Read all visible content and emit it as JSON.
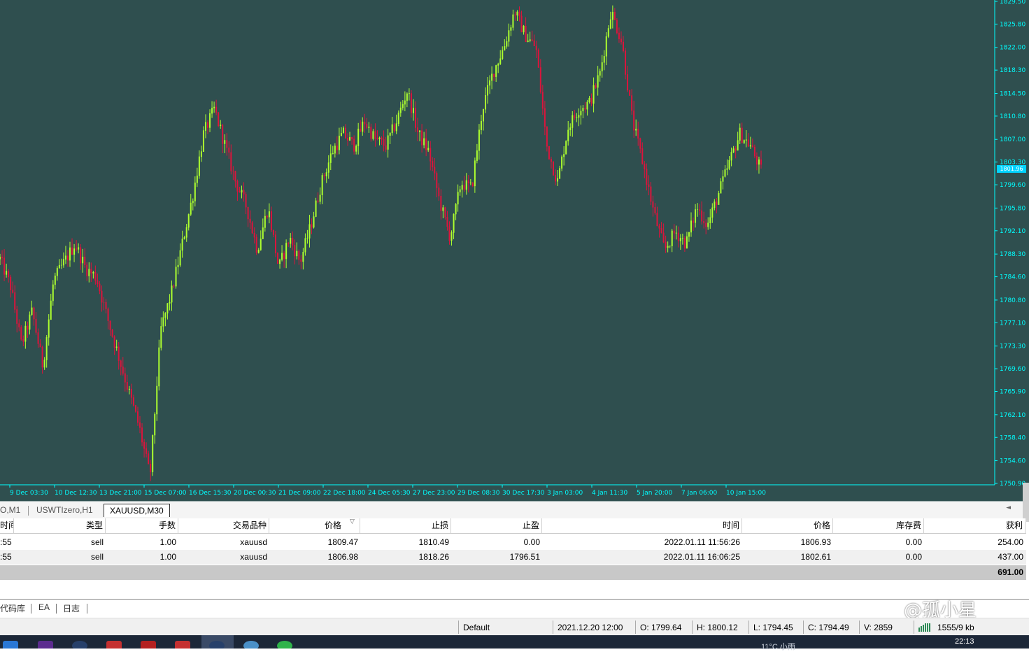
{
  "chart": {
    "price_tag": "1801.96",
    "y_ticks": [
      "1829.50",
      "1825.80",
      "1822.00",
      "1818.30",
      "1814.50",
      "1810.80",
      "1807.00",
      "1803.30",
      "1799.60",
      "1795.80",
      "1792.10",
      "1788.30",
      "1784.60",
      "1780.80",
      "1777.10",
      "1773.30",
      "1769.60",
      "1765.90",
      "1762.10",
      "1758.40",
      "1754.60",
      "1750.90"
    ],
    "x_ticks": [
      "9 Dec 03:30",
      "10 Dec 12:30",
      "13 Dec 21:00",
      "15 Dec 07:00",
      "16 Dec 15:30",
      "20 Dec 00:30",
      "21 Dec 09:00",
      "22 Dec 18:00",
      "24 Dec 05:30",
      "27 Dec 23:00",
      "29 Dec 08:30",
      "30 Dec 17:30",
      "3 Jan 03:00",
      "4 Jan 11:30",
      "5 Jan 20:00",
      "7 Jan 06:00",
      "10 Jan 15:00"
    ],
    "colors": {
      "background": "#2f4f4f",
      "up": "#adff2f",
      "down": "#dc143c",
      "axis": "#00ffff"
    }
  },
  "chart_data": {
    "type": "candlestick",
    "symbol": "XAUUSD",
    "timeframe": "M30",
    "ylim": [
      1750.9,
      1829.5
    ],
    "close_path": [
      [
        "9 Dec 03:30",
        1787.5
      ],
      [
        "",
        1783.0
      ],
      [
        "",
        1773.5
      ],
      [
        "",
        1779.0
      ],
      [
        "",
        1770.0
      ],
      [
        "10 Dec 12:30",
        1784.0
      ],
      [
        "",
        1787.0
      ],
      [
        "",
        1790.0
      ],
      [
        "",
        1786.0
      ],
      [
        "13 Dec 21:00",
        1784.5
      ],
      [
        "",
        1778.0
      ],
      [
        "",
        1772.0
      ],
      [
        "",
        1766.0
      ],
      [
        "",
        1760.0
      ],
      [
        "",
        1752.0
      ],
      [
        "15 Dec 07:00",
        1776.0
      ],
      [
        "",
        1782.0
      ],
      [
        "",
        1790.0
      ],
      [
        "16 Dec 15:30",
        1798.0
      ],
      [
        "",
        1808.0
      ],
      [
        "",
        1812.0
      ],
      [
        "",
        1806.0
      ],
      [
        "20 Dec 00:30",
        1800.0
      ],
      [
        "",
        1796.0
      ],
      [
        "",
        1789.0
      ],
      [
        "21 Dec 09:00",
        1796.0
      ],
      [
        "",
        1786.0
      ],
      [
        "",
        1791.0
      ],
      [
        "",
        1787.0
      ],
      [
        "",
        1793.0
      ],
      [
        "22 Dec 18:00",
        1800.0
      ],
      [
        "",
        1805.0
      ],
      [
        "",
        1808.0
      ],
      [
        "",
        1806.0
      ],
      [
        "24 Dec 05:30",
        1810.0
      ],
      [
        "",
        1807.0
      ],
      [
        "",
        1806.0
      ],
      [
        "27 Dec 23:00",
        1810.0
      ],
      [
        "",
        1815.0
      ],
      [
        "",
        1808.0
      ],
      [
        "",
        1805.0
      ],
      [
        "29 Dec 08:30",
        1797.0
      ],
      [
        "",
        1791.0
      ],
      [
        "",
        1800.0
      ],
      [
        "",
        1799.0
      ],
      [
        "30 Dec 17:30",
        1812.0
      ],
      [
        "",
        1818.0
      ],
      [
        "",
        1822.0
      ],
      [
        "",
        1828.0
      ],
      [
        "3 Jan 03:00",
        1824.0
      ],
      [
        "",
        1822.0
      ],
      [
        "",
        1806.0
      ],
      [
        "",
        1800.0
      ],
      [
        "4 Jan 11:30",
        1809.0
      ],
      [
        "",
        1812.0
      ],
      [
        "",
        1813.0
      ],
      [
        "",
        1818.0
      ],
      [
        "",
        1828.0
      ],
      [
        "5 Jan 20:00",
        1823.0
      ],
      [
        "",
        1810.0
      ],
      [
        "",
        1803.0
      ],
      [
        "",
        1795.0
      ],
      [
        "",
        1789.0
      ],
      [
        "7 Jan 06:00",
        1792.0
      ],
      [
        "",
        1790.0
      ],
      [
        "",
        1796.0
      ],
      [
        "",
        1793.0
      ],
      [
        "10 Jan 15:00",
        1798.0
      ],
      [
        "",
        1803.0
      ],
      [
        "",
        1808.0
      ],
      [
        "",
        1806.0
      ],
      [
        "",
        1801.96
      ]
    ]
  },
  "tabs": {
    "items": [
      "O,M1",
      "USWTIzero,H1",
      "XAUUSD,M30"
    ],
    "active": "XAUUSD,M30"
  },
  "trade_grid": {
    "headers": [
      "时间",
      "类型",
      "手数",
      "交易品种",
      "价格",
      "止损",
      "止盈",
      "时间",
      "价格",
      "库存费",
      "获利"
    ],
    "rows": [
      [
        ":55",
        "sell",
        "1.00",
        "xauusd",
        "1809.47",
        "1810.49",
        "0.00",
        "2022.01.11 11:56:26",
        "1806.93",
        "0.00",
        "254.00"
      ],
      [
        ":55",
        "sell",
        "1.00",
        "xauusd",
        "1806.98",
        "1818.26",
        "1796.51",
        "2022.01.11 16:06:25",
        "1802.61",
        "0.00",
        "437.00"
      ]
    ],
    "total": "691.00"
  },
  "bottom_tabs": [
    "代码库",
    "EA",
    "日志"
  ],
  "status_bar": {
    "profile": "Default",
    "datetime": "2021.12.20 12:00",
    "open": "O: 1799.64",
    "high": "H: 1800.12",
    "low": "L: 1794.45",
    "close": "C: 1794.49",
    "volume": "V: 2859",
    "traffic": "1555/9 kb"
  },
  "watermark": "@孤小星",
  "taskbar": {
    "weather": "11°C 小雨",
    "time": "22:13"
  }
}
